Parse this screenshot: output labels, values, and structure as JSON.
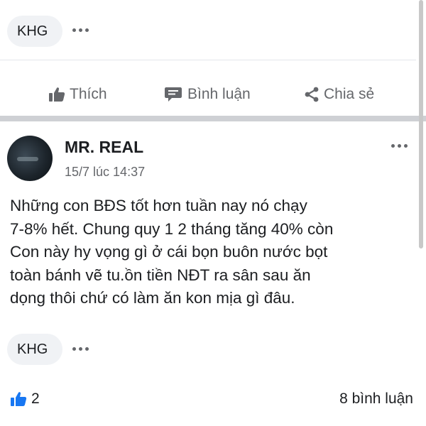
{
  "top_reply": {
    "chip": "KHG"
  },
  "actions": {
    "like": "Thích",
    "comment": "Bình luận",
    "share": "Chia sẻ"
  },
  "post": {
    "author": "MR. REAL",
    "time": "15/7 lúc 14:37",
    "lines": [
      "Những con BĐS tốt hơn tuần nay nó chạy",
      "7-8% hết. Chung quy 1 2 tháng tăng 40% còn",
      "Con này hy vọng gì ở cái bọn buôn nước bọt",
      "toàn bánh vẽ tu.ồn tiền NĐT ra sân sau ăn",
      "dọng thôi chứ có làm ăn kon mịa gì đâu."
    ]
  },
  "bottom_reply": {
    "chip": "KHG"
  },
  "footer": {
    "like_count": "2",
    "comment_count": "8 bình luận"
  },
  "colors": {
    "accent": "#1877f2",
    "muted": "#65676b",
    "chip_bg": "#f0f2f5"
  }
}
